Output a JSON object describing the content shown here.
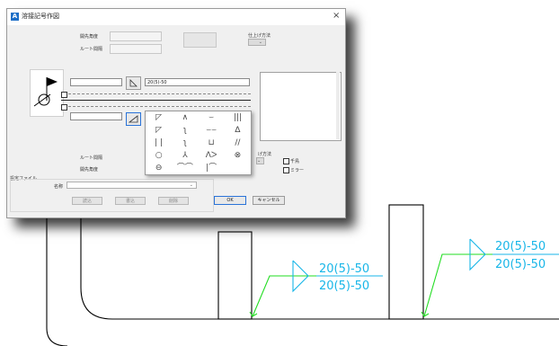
{
  "dialog": {
    "title": "溶接記号作図",
    "close_glyph": "×",
    "labels": {
      "upper_open_angle": "開先角度",
      "upper_root_gap": "ルート間隔",
      "finish_method_top": "仕上げ方法",
      "lower_root_gap": "ルート間隔",
      "lower_open_angle": "開先角度",
      "finish_method_bottom": "げ方法"
    },
    "inputs": {
      "reference_text": "20(5)-50"
    },
    "checkboxes": {
      "staggered": "千鳥",
      "mirror": "ミラー"
    },
    "settings_file": {
      "group_label": "設定ファイル",
      "name_label": "名称",
      "read_button": "読込",
      "write_button": "書込",
      "delete_button": "削除"
    },
    "ok_button": "OK",
    "cancel_button": "キャンセル"
  },
  "palette": {
    "symbols": [
      "◸",
      "∧",
      "⌣",
      "|||",
      "◸",
      "ʅ",
      "⌣⌣",
      "∆",
      "| |",
      "ʅ",
      "⊔",
      "//",
      "○",
      "⅄",
      "ᐱᐳ",
      "⊗",
      "⊖",
      "⌒⌒",
      "|⌒",
      ""
    ]
  },
  "cad": {
    "weld_labels_1": [
      "20(5)-50",
      "20(5)-50"
    ],
    "weld_labels_2": [
      "20(5)-50",
      "20(5)-50"
    ],
    "colors": {
      "weld_text": "#18b6e8",
      "leader": "#22dd22",
      "structure": "#000000"
    }
  }
}
